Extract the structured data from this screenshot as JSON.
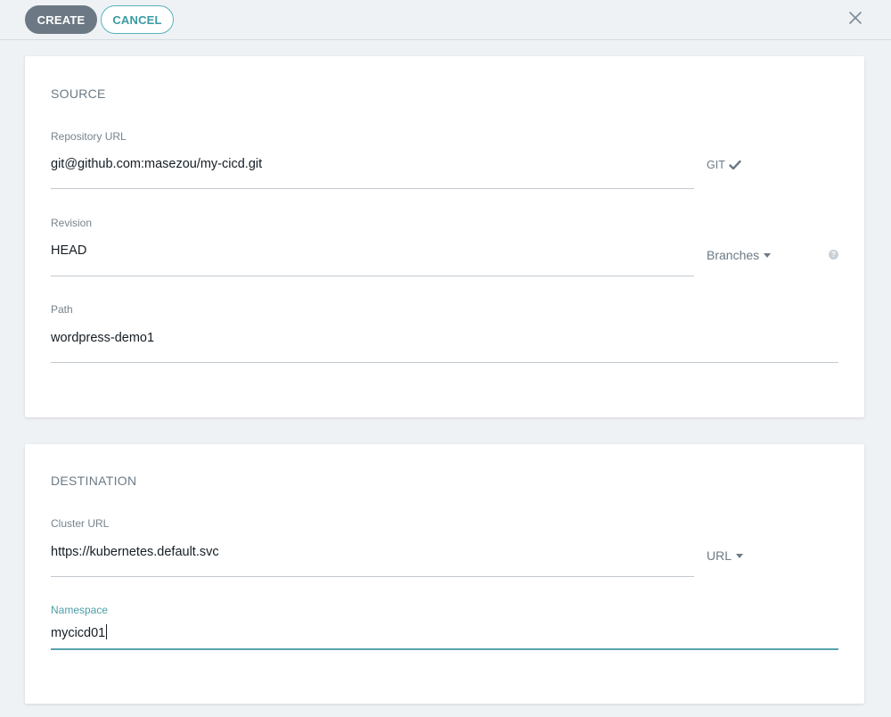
{
  "toolbar": {
    "create_label": "CREATE",
    "cancel_label": "CANCEL",
    "close_icon": "close-icon"
  },
  "source": {
    "title": "SOURCE",
    "repo_url": {
      "label": "Repository URL",
      "value": "git@github.com:masezou/my-cicd.git",
      "type_label": "GIT",
      "type_icon": "checkmark-icon"
    },
    "revision": {
      "label": "Revision",
      "value": "HEAD",
      "selector_label": "Branches",
      "help_icon": "question-icon"
    },
    "path": {
      "label": "Path",
      "value": "wordpress-demo1"
    }
  },
  "destination": {
    "title": "DESTINATION",
    "cluster_url": {
      "label": "Cluster URL",
      "value": "https://kubernetes.default.svc",
      "selector_label": "URL"
    },
    "namespace": {
      "label": "Namespace",
      "value": "mycicd01"
    }
  },
  "colors": {
    "background": "#eff2f5",
    "primary_button": "#6c7984",
    "accent": "#55b3bb",
    "active_field": "#5aa3aa"
  }
}
